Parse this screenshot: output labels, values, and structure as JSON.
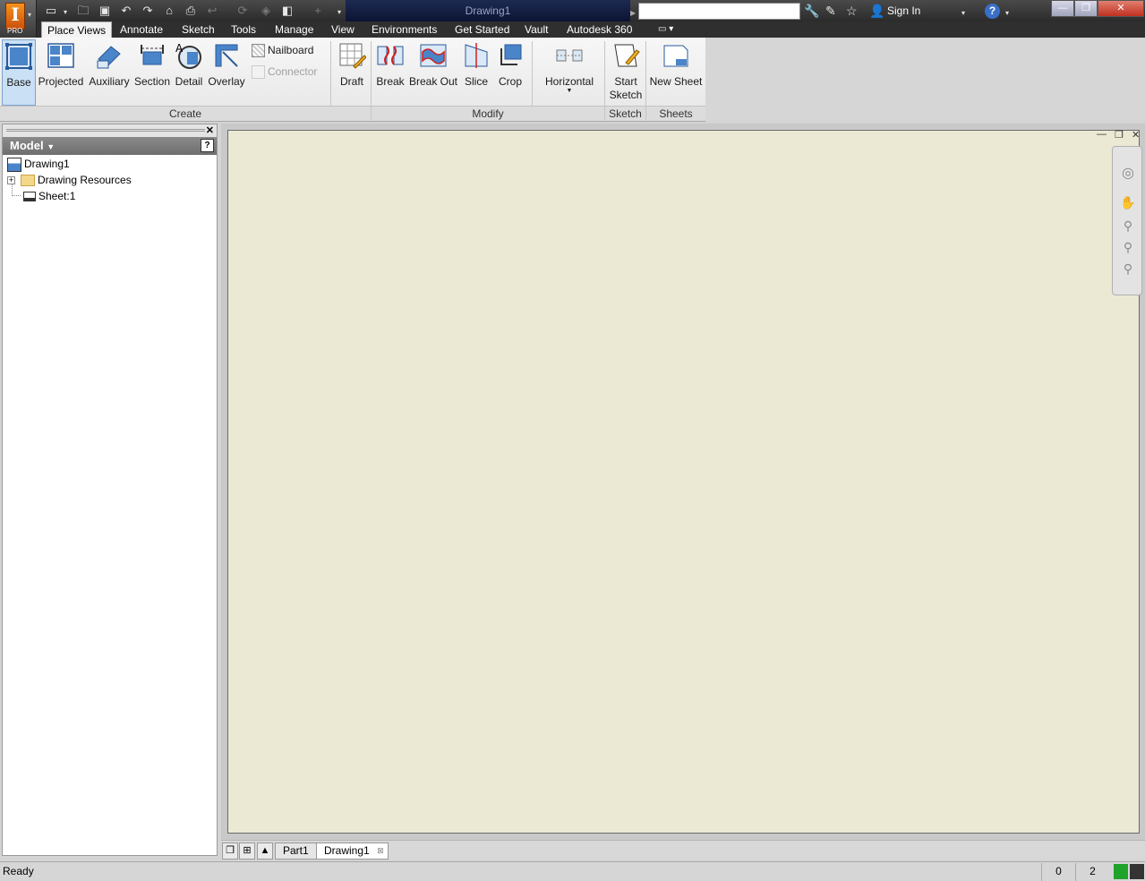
{
  "title_bar": {
    "document_title": "Drawing1",
    "app_badge": "PRO",
    "sign_in_label": "Sign In",
    "help_label": "?",
    "search_placeholder": ""
  },
  "ribbon_tabs": [
    {
      "label": "Place Views",
      "active": true
    },
    {
      "label": "Annotate"
    },
    {
      "label": "Sketch"
    },
    {
      "label": "Tools"
    },
    {
      "label": "Manage"
    },
    {
      "label": "View"
    },
    {
      "label": "Environments"
    },
    {
      "label": "Get Started"
    },
    {
      "label": "Vault"
    },
    {
      "label": "Autodesk 360"
    }
  ],
  "ribbon": {
    "create": {
      "label": "Create",
      "buttons": [
        "Base",
        "Projected",
        "Auxiliary",
        "Section",
        "Detail",
        "Overlay"
      ],
      "small_buttons": [
        "Nailboard",
        "Connector"
      ],
      "draft": "Draft"
    },
    "modify": {
      "label": "Modify",
      "buttons": [
        "Break",
        "Break Out",
        "Slice",
        "Crop",
        "Horizontal"
      ]
    },
    "sketch": {
      "label": "Sketch",
      "start_line1": "Start",
      "start_line2": "Sketch"
    },
    "sheets": {
      "label": "Sheets",
      "new_sheet": "New Sheet"
    }
  },
  "browser": {
    "header": "Model",
    "help_label": "?",
    "tree": [
      {
        "label": "Drawing1"
      },
      {
        "label": "Drawing Resources"
      },
      {
        "label": "Sheet:1"
      }
    ]
  },
  "doc_tabs": [
    {
      "label": "Part1"
    },
    {
      "label": "Drawing1",
      "active": true
    }
  ],
  "status_bar": {
    "text": "Ready",
    "count1": "0",
    "count2": "2"
  },
  "colors": {
    "canvas": "#ebe9d4",
    "title_bar": "#2b2b2b",
    "active_button": "#c9e0f5",
    "status_ok": "#1fa32b"
  }
}
